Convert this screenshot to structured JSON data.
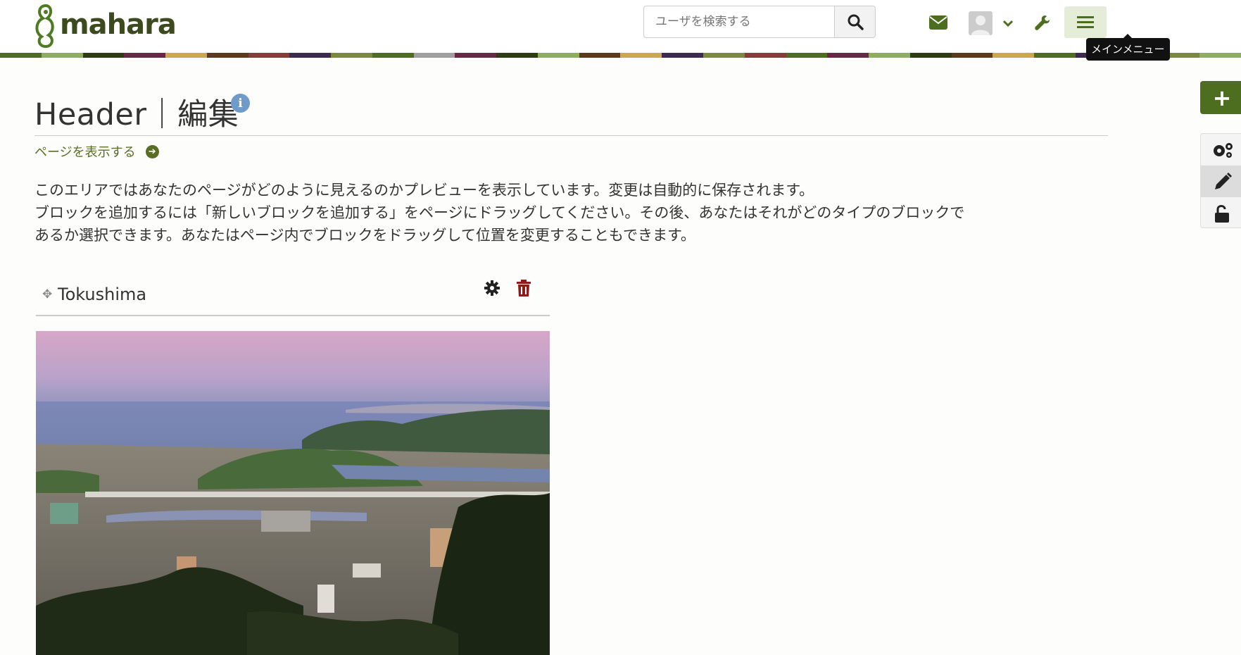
{
  "header": {
    "logo_text": "mahara",
    "search_placeholder": "ユーザを検索する",
    "menu_tooltip": "メインメニュー"
  },
  "colors": {
    "brand_green": "#4e6e1f",
    "link_green": "#5a6e23",
    "info_blue": "#6e9bc9",
    "delete_red": "#8e1b1b"
  },
  "icons": [
    "mahara-logo-icon",
    "search-icon",
    "envelope-icon",
    "user-avatar-icon",
    "chevron-down-icon",
    "wrench-icon",
    "hamburger-menu-icon",
    "info-icon",
    "arrow-right-circle-icon",
    "move-icon",
    "gear-icon",
    "trash-icon",
    "plus-icon",
    "cogs-icon",
    "pencil-icon",
    "unlock-icon"
  ],
  "page": {
    "title": "Header｜編集",
    "view_link": "ページを表示する",
    "description": [
      "このエリアではあなたのページがどのように見えるのかプレビューを表示しています。変更は自動的に保存されます。",
      "ブロックを追加するには「新しいブロックを追加する」をページにドラッグしてください。その後、あなたはそれがどのタイプのブロックで",
      "あるか選択できます。あなたはページ内でブロックをドラッグして位置を変更することもできます。"
    ]
  },
  "block": {
    "title": "Tokushima"
  },
  "sidebar": {
    "add_label": "+"
  }
}
